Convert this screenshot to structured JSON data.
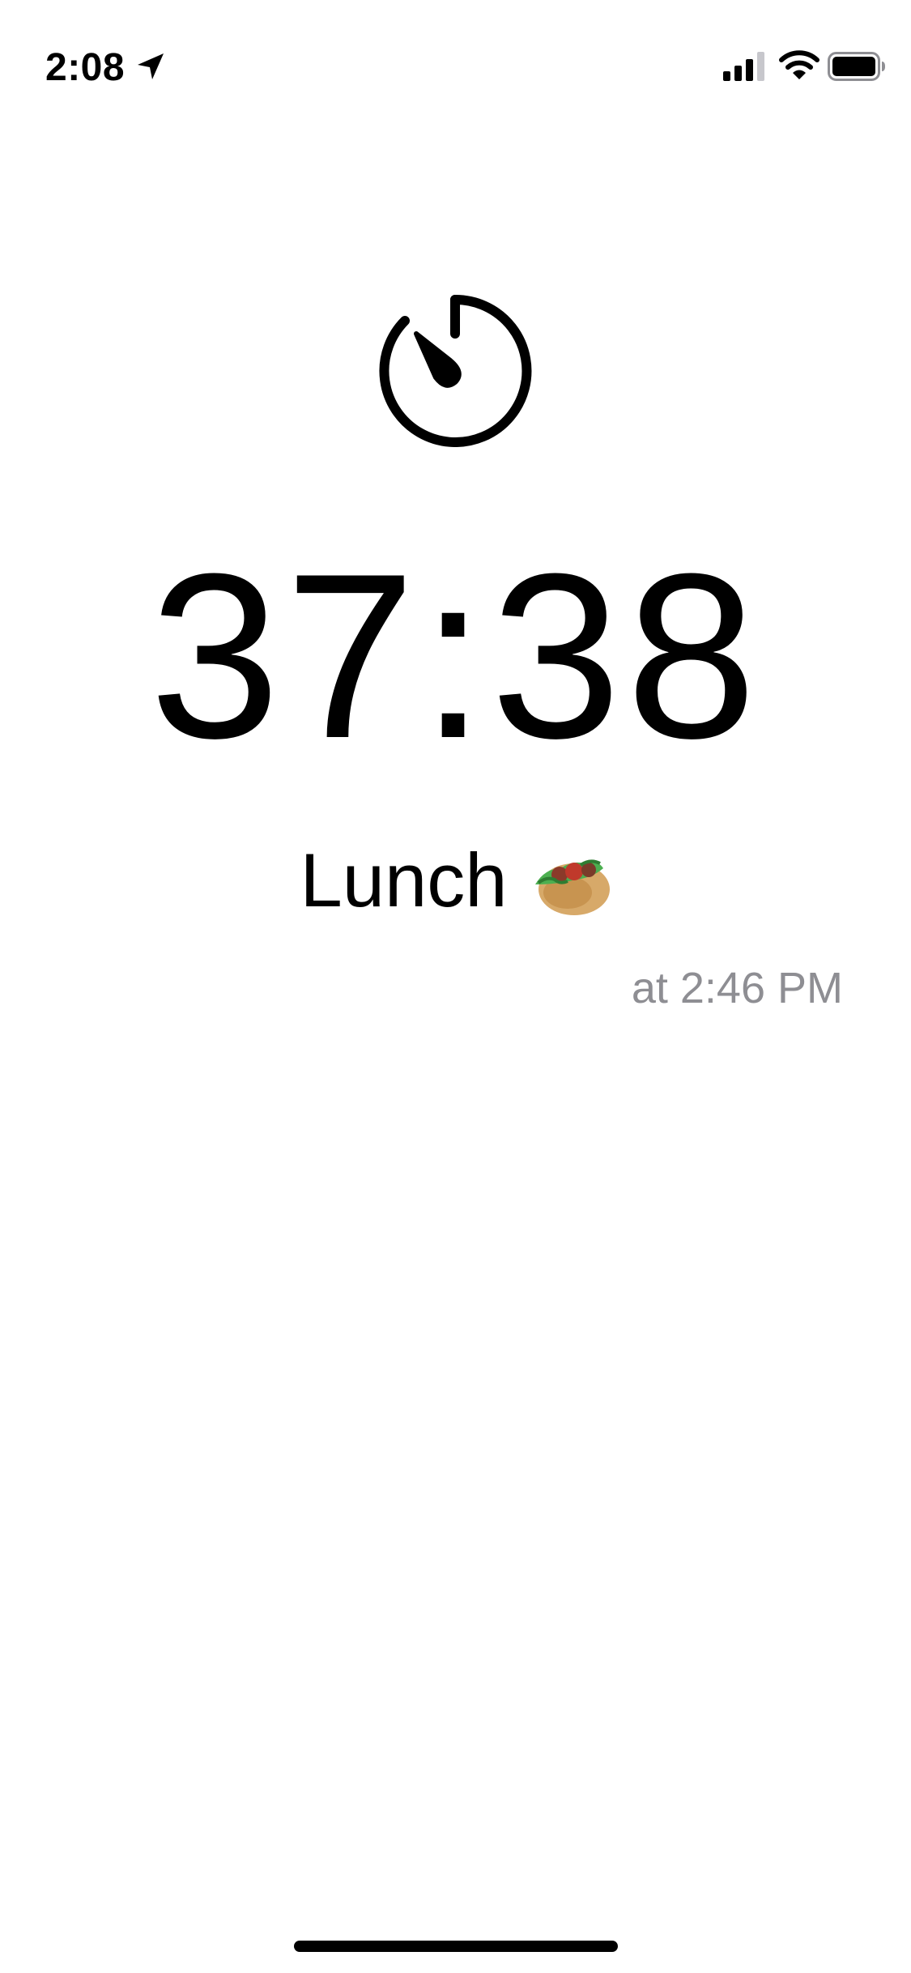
{
  "status_bar": {
    "time": "2:08",
    "icons": [
      "location-arrow-icon",
      "cellular-signal-icon",
      "wifi-icon",
      "battery-icon"
    ]
  },
  "timer": {
    "icon": "timer-icon",
    "remaining": "37:38",
    "label": "Lunch",
    "emoji": "stuffed-flatbread-emoji",
    "alarm_time": "at 2:46 PM"
  },
  "colors": {
    "background": "#ffffff",
    "foreground": "#000000",
    "secondary_text": "#8e8e93"
  }
}
